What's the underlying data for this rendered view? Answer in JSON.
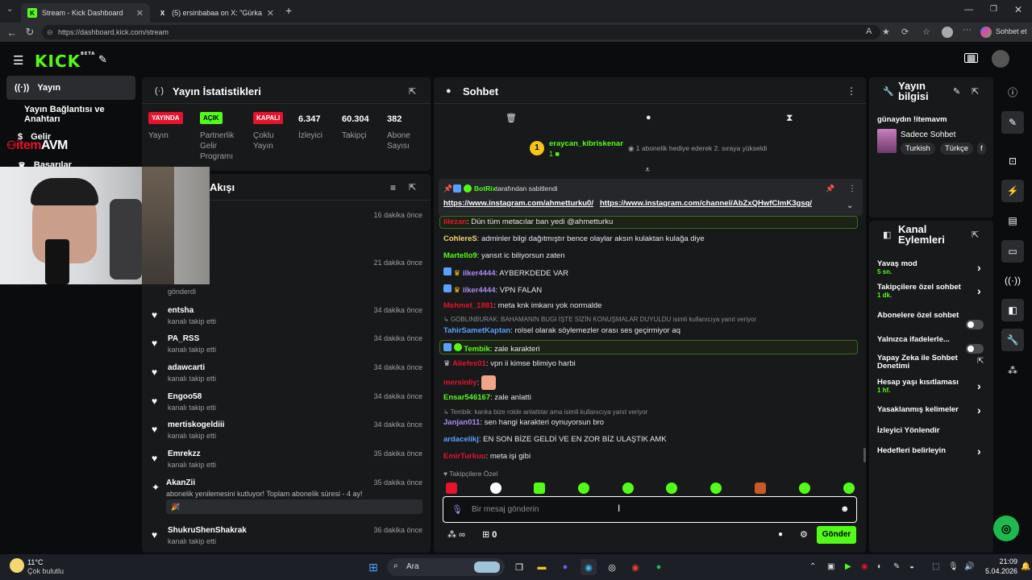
{
  "browser": {
    "tabs": [
      {
        "title": "Stream - Kick Dashboard",
        "icon": "kick-favicon"
      },
      {
        "title": "(5) ersinbabaa on X: \"Gürkan🙈 h",
        "icon": "x-favicon"
      }
    ],
    "url": "https://dashboard.kick.com/stream",
    "copilot_label": "Sohbet et"
  },
  "brand": {
    "logo": "KICK",
    "beta": "BETA"
  },
  "sidebar": {
    "items": [
      {
        "label": "Yayın",
        "icon": "broadcast-icon"
      },
      {
        "label": "Yayın Bağlantısı ve Anahtarı",
        "icon": ""
      },
      {
        "label": "Gelir",
        "icon": "coin-icon"
      },
      {
        "label": "Başarılar",
        "icon": "trophy-icon"
      }
    ]
  },
  "overlay": {
    "logo_text_1": "item",
    "logo_text_2": "AVM"
  },
  "stats": {
    "title": "Yayın İstatistikleri",
    "cols": [
      {
        "badge": "YAYINDA",
        "badge_color": "#e5132b",
        "label": "Yayın"
      },
      {
        "badge": "AÇIK",
        "badge_color": "#53fc18",
        "label": "Partnerlik Gelir Programı"
      },
      {
        "badge": "KAPALI",
        "badge_color": "#e5132b",
        "label": "Çoklu Yayın"
      },
      {
        "value": "6.347",
        "label": "İzleyici"
      },
      {
        "value": "60.304",
        "label": "Takipçi"
      },
      {
        "value": "382",
        "label": "Abone Sayısı"
      }
    ]
  },
  "activity": {
    "title": "Akışı",
    "items": [
      {
        "name": "",
        "sub": "",
        "time": "16 dakika önce"
      },
      {
        "name": "",
        "sub": "gönderdi",
        "time": "21 dakika önce"
      },
      {
        "name": "entsha",
        "sub": "kanalı takip etti",
        "time": "34 dakika önce"
      },
      {
        "name": "PA_RSS",
        "sub": "kanalı takip etti",
        "time": "34 dakika önce"
      },
      {
        "name": "adawcarti",
        "sub": "kanalı takip etti",
        "time": "34 dakika önce"
      },
      {
        "name": "Engoo58",
        "sub": "kanalı takip etti",
        "time": "34 dakika önce"
      },
      {
        "name": "mertiskogeldiii",
        "sub": "kanalı takip etti",
        "time": "34 dakika önce"
      },
      {
        "name": "Emrekzz",
        "sub": "kanalı takip etti",
        "time": "35 dakika önce"
      },
      {
        "name": "AkanZii",
        "sub": "abonelik yenilemesini kutluyor! Toplam abonelik süresi - 4 ay!",
        "time": "35 dakika önce"
      },
      {
        "name": "ShukruShenShakrak",
        "sub": "kanalı takip etti",
        "time": "36 dakika önce"
      }
    ]
  },
  "chat": {
    "title": "Sohbet",
    "top_user": "eraycan_kibriskenar",
    "top_user_count": "1",
    "top_note": "1 abonelik hediye ederek 2. sıraya yükseldi",
    "pinned_by": "BotRix",
    "pinned_label": "tarafından sabitlendi",
    "pinned_link1": "https://www.instagram.com/ahmetturku0/",
    "pinned_link2": "https://www.instagram.com/channel/AbZxQHwfClmK3gsq/",
    "messages": [
      {
        "user": "lilezan",
        "color": "#e5132b",
        "text": "Dün tüm metacılar ban yedi @ahmetturku"
      },
      {
        "user": "CohlereS",
        "color": "#f5d76e",
        "text": "adminler bilgi dağıtmıştır bence olaylar aksın kulaktan kulağa diye"
      },
      {
        "user": "Martello9",
        "color": "#53fc18",
        "text": "yansıt ic biliyorsun zaten"
      },
      {
        "user": "ilker4444",
        "color": "#a98cf5",
        "text": "AYBERKDEDE VAR"
      },
      {
        "user": "ilker4444",
        "color": "#a98cf5",
        "text": "VPN FALAN"
      },
      {
        "user": "Mehmet_1881",
        "color": "#e5132b",
        "text": "meta knk imkanı yok normalde"
      },
      {
        "reply": "GOBLINBURAK: BAHAMANIN BUGI İŞTE SİZİN KONUŞMALAR DUYULDU isimli kullanıcıya yanıt veriyor",
        "user": "TahirSametKaptan",
        "color": "#5aa0ff",
        "text": "rolsel olarak söylemezler orası ses geçirmiyor aq"
      },
      {
        "user": "Tembik",
        "color": "#53fc18",
        "text": "zale karakteri"
      },
      {
        "user": "Aliefes01",
        "color": "#e5132b",
        "text": "vpn ii kimse blimiyo harbi"
      },
      {
        "user": "mersinliy",
        "color": "#e5132b",
        "text": ""
      },
      {
        "user": "Ensar546167",
        "color": "#53fc18",
        "text": "zale anlatti"
      },
      {
        "reply": "Tembik: kanka bize rolde anlattılar ama isimli kullanıcıya yanıt veriyor",
        "user": "Janjan011",
        "color": "#a98cf5",
        "text": "sen hangi karakteri oynuyorsun bro"
      },
      {
        "user": "ardacelikj",
        "color": "#5aa0ff",
        "text": "EN SON BİZE GELDİ VE EN ZOR BİZ ULAŞTIK AMK"
      },
      {
        "user": "EmirTurkuu",
        "color": "#e5132b",
        "text": "meta işi gibi"
      }
    ],
    "followers_only": "Takipçilere Özel",
    "input_placeholder": "Bir mesaj gönderin",
    "points": "∞",
    "gifts": "0",
    "send_label": "Gönder"
  },
  "stream_info": {
    "title": "Yayın bilgisi",
    "stream_title": "günaydın !itemavm",
    "category": "Sadece Sohbet",
    "tags": [
      "Turkish",
      "Türkçe",
      "f"
    ]
  },
  "channel_actions": {
    "title": "Kanal Eylemleri",
    "items": [
      {
        "label": "Yavaş mod",
        "sub": "5 sn.",
        "control": "chevron"
      },
      {
        "label": "Takipçilere özel sohbet",
        "sub": "1 dk.",
        "control": "chevron"
      },
      {
        "label": "Abonelere özel sohbet",
        "sub": "",
        "control": "toggle"
      },
      {
        "label": "Yalnızca ifadelerle...",
        "sub": "",
        "control": "toggle"
      },
      {
        "label": "Yapay Zeka ile Sohbet Denetimi",
        "sub": "",
        "control": "external"
      },
      {
        "label": "Hesap yaşı kısıtlaması",
        "sub": "1 hf.",
        "control": "chevron"
      },
      {
        "label": "Yasaklanmış kelimeler",
        "sub": "",
        "control": "chevron"
      },
      {
        "label": "İzleyici Yönlendir",
        "sub": "",
        "control": "none"
      },
      {
        "label": "Hedefleri belirleyin",
        "sub": "",
        "control": "chevron"
      }
    ]
  },
  "taskbar": {
    "weather_temp": "11°C",
    "weather_desc": "Çok bulutlu",
    "search": "Ara",
    "time": "21:09",
    "date": "5.04.2026"
  },
  "colors": {
    "accent": "#53fc18",
    "danger": "#e5132b"
  }
}
